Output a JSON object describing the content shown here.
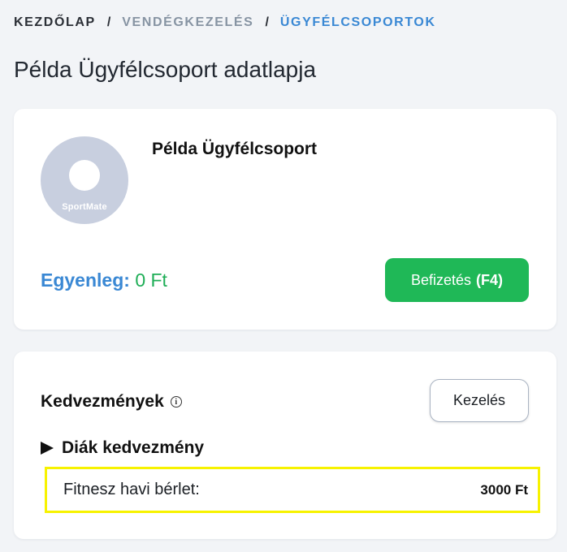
{
  "breadcrumb": {
    "items": [
      "KEZDŐLAP",
      "VENDÉGKEZELÉS",
      "ÜGYFÉLCSOPORTOK"
    ],
    "separator": "/"
  },
  "page": {
    "title": "Példa Ügyfélcsoport adatlapja"
  },
  "profile": {
    "name": "Példa Ügyfélcsoport",
    "avatar_logo": "SportMate",
    "balance_label": "Egyenleg:",
    "balance_value": "0 Ft",
    "pay_button_label": "Befizetés",
    "pay_button_shortcut": "(F4)"
  },
  "discounts": {
    "title": "Kedvezmények",
    "info_icon": "i",
    "manage_button_label": "Kezelés",
    "groups": [
      {
        "label": "Diák kedvezmény",
        "items": [
          {
            "name": "Fitnesz havi bérlet:",
            "price": "3000 Ft"
          }
        ]
      }
    ]
  },
  "colors": {
    "background": "#f2f4f7",
    "accent_blue": "#3a88d4",
    "success_green": "#1fb857",
    "highlight_yellow": "#f7f200",
    "breadcrumb_muted": "#8794a3"
  }
}
